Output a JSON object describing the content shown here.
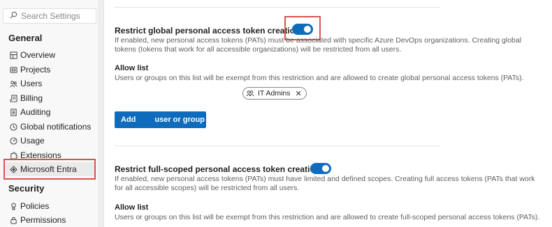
{
  "sidebar": {
    "search": {
      "placeholder": "Search Settings"
    },
    "sections": [
      {
        "title": "General",
        "items": [
          {
            "label": "Overview",
            "icon": "overview-icon"
          },
          {
            "label": "Projects",
            "icon": "projects-icon"
          },
          {
            "label": "Users",
            "icon": "users-icon"
          },
          {
            "label": "Billing",
            "icon": "billing-icon"
          },
          {
            "label": "Auditing",
            "icon": "auditing-icon"
          },
          {
            "label": "Global notifications",
            "icon": "notifications-icon"
          },
          {
            "label": "Usage",
            "icon": "usage-icon"
          },
          {
            "label": "Extensions",
            "icon": "extensions-icon"
          },
          {
            "label": "Microsoft Entra",
            "icon": "entra-icon",
            "selected": true
          }
        ]
      },
      {
        "title": "Security",
        "items": [
          {
            "label": "Policies",
            "icon": "policies-icon"
          },
          {
            "label": "Permissions",
            "icon": "permissions-icon"
          }
        ]
      }
    ]
  },
  "main": {
    "policies": [
      {
        "title": "Restrict global personal access token creation",
        "enabled": true,
        "description": "If enabled, new personal access tokens (PATs) must be associated with specific Azure DevOps organizations. Creating global tokens (tokens that work for all accessible organizations) will be restricted from all users.",
        "allow_list_label": "Allow list",
        "allow_list_description": "Users or groups on this list will be exempt from this restriction and are allowed to create global personal access tokens (PATs).",
        "allow_list_entries": [
          {
            "label": "IT Admins",
            "icon": "group-icon"
          }
        ],
        "add_button_label": "Add",
        "add_button_suffix": "user or group"
      },
      {
        "title": "Restrict full-scoped personal access token creation",
        "enabled": true,
        "description": "If enabled, new personal access tokens (PATs) must have limited and defined scopes. Creating full access tokens (PATs that work for all accessible scopes) will be restricted from all users.",
        "allow_list_label": "Allow list",
        "allow_list_description": "Users or groups on this list will be exempt from this restriction and are allowed to create full-scoped personal access tokens (PATs)."
      }
    ]
  },
  "colors": {
    "accent": "#0f6cbd",
    "highlight": "#d9534f",
    "sidebar_bg": "#f8f8f8",
    "muted_text": "#605e5c"
  }
}
